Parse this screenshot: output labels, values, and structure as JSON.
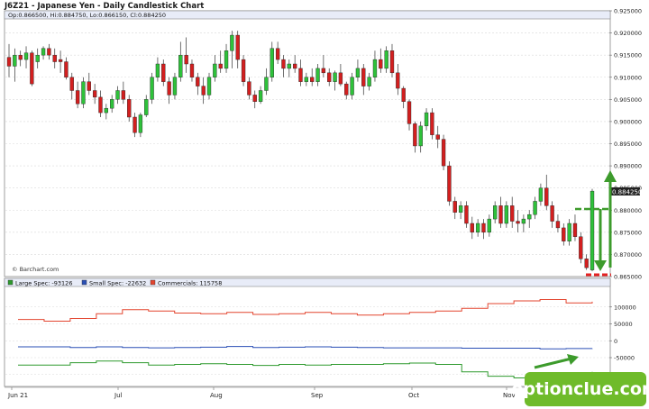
{
  "chart_data": [
    {
      "type": "candlestick",
      "title": "J6Z21 - Japanese Yen - Daily Candlestick Chart",
      "ohlc_label": "Op:0.866500, Hi:0.884750, Lo:0.866150, Cl:0.884250",
      "last_price": "0.884250",
      "credit": "© Barchart.com",
      "ylim": [
        0.865,
        0.925
      ],
      "y_ticks": [
        "0.925000",
        "0.920000",
        "0.915000",
        "0.910000",
        "0.905000",
        "0.900000",
        "0.895000",
        "0.890000",
        "0.885000",
        "0.880000",
        "0.875000",
        "0.870000",
        "0.865000"
      ],
      "x_ticks": [
        "Jun 21",
        "Jul",
        "Aug",
        "Sep",
        "Oct",
        "Nov"
      ],
      "up_color": "#2ec13a",
      "down_color": "#d21f1f",
      "candles": [
        [
          0.9145,
          0.9175,
          0.91,
          0.9125
        ],
        [
          0.9125,
          0.9165,
          0.909,
          0.915
        ],
        [
          0.915,
          0.916,
          0.9125,
          0.914
        ],
        [
          0.914,
          0.917,
          0.912,
          0.9155
        ],
        [
          0.9155,
          0.916,
          0.908,
          0.9085
        ],
        [
          0.9135,
          0.9165,
          0.912,
          0.915
        ],
        [
          0.915,
          0.917,
          0.914,
          0.9165
        ],
        [
          0.9165,
          0.9175,
          0.914,
          0.915
        ],
        [
          0.915,
          0.9165,
          0.912,
          0.9135
        ],
        [
          0.914,
          0.916,
          0.911,
          0.9135
        ],
        [
          0.9135,
          0.9145,
          0.9095,
          0.91
        ],
        [
          0.91,
          0.911,
          0.905,
          0.907
        ],
        [
          0.907,
          0.909,
          0.903,
          0.904
        ],
        [
          0.904,
          0.91,
          0.903,
          0.909
        ],
        [
          0.909,
          0.911,
          0.906,
          0.907
        ],
        [
          0.907,
          0.9085,
          0.904,
          0.9055
        ],
        [
          0.9055,
          0.907,
          0.901,
          0.902
        ],
        [
          0.902,
          0.904,
          0.9005,
          0.903
        ],
        [
          0.903,
          0.906,
          0.902,
          0.905
        ],
        [
          0.905,
          0.908,
          0.904,
          0.907
        ],
        [
          0.907,
          0.909,
          0.904,
          0.905
        ],
        [
          0.905,
          0.906,
          0.9,
          0.901
        ],
        [
          0.901,
          0.902,
          0.8965,
          0.8975
        ],
        [
          0.8975,
          0.902,
          0.8965,
          0.9015
        ],
        [
          0.9015,
          0.906,
          0.901,
          0.905
        ],
        [
          0.905,
          0.911,
          0.904,
          0.91
        ],
        [
          0.91,
          0.9145,
          0.909,
          0.913
        ],
        [
          0.913,
          0.914,
          0.908,
          0.909
        ],
        [
          0.909,
          0.91,
          0.904,
          0.906
        ],
        [
          0.906,
          0.911,
          0.905,
          0.91
        ],
        [
          0.91,
          0.918,
          0.909,
          0.915
        ],
        [
          0.915,
          0.919,
          0.911,
          0.913
        ],
        [
          0.913,
          0.914,
          0.909,
          0.91
        ],
        [
          0.91,
          0.911,
          0.906,
          0.908
        ],
        [
          0.908,
          0.91,
          0.904,
          0.906
        ],
        [
          0.906,
          0.911,
          0.905,
          0.91
        ],
        [
          0.91,
          0.915,
          0.909,
          0.913
        ],
        [
          0.913,
          0.916,
          0.911,
          0.912
        ],
        [
          0.912,
          0.9175,
          0.911,
          0.916
        ],
        [
          0.916,
          0.9205,
          0.912,
          0.9195
        ],
        [
          0.9195,
          0.9205,
          0.912,
          0.914
        ],
        [
          0.914,
          0.915,
          0.908,
          0.909
        ],
        [
          0.909,
          0.91,
          0.905,
          0.906
        ],
        [
          0.906,
          0.907,
          0.903,
          0.9045
        ],
        [
          0.9045,
          0.908,
          0.904,
          0.907
        ],
        [
          0.907,
          0.912,
          0.906,
          0.91
        ],
        [
          0.91,
          0.918,
          0.909,
          0.9165
        ],
        [
          0.9165,
          0.918,
          0.913,
          0.914
        ],
        [
          0.914,
          0.915,
          0.91,
          0.912
        ],
        [
          0.912,
          0.914,
          0.91,
          0.913
        ],
        [
          0.913,
          0.915,
          0.911,
          0.912
        ],
        [
          0.912,
          0.914,
          0.908,
          0.909
        ],
        [
          0.909,
          0.911,
          0.908,
          0.91
        ],
        [
          0.91,
          0.912,
          0.908,
          0.909
        ],
        [
          0.909,
          0.913,
          0.908,
          0.912
        ],
        [
          0.912,
          0.915,
          0.91,
          0.911
        ],
        [
          0.911,
          0.912,
          0.908,
          0.909
        ],
        [
          0.909,
          0.9115,
          0.907,
          0.911
        ],
        [
          0.911,
          0.913,
          0.908,
          0.9085
        ],
        [
          0.9085,
          0.909,
          0.905,
          0.906
        ],
        [
          0.906,
          0.911,
          0.905,
          0.91
        ],
        [
          0.91,
          0.914,
          0.909,
          0.912
        ],
        [
          0.912,
          0.913,
          0.906,
          0.908
        ],
        [
          0.908,
          0.911,
          0.907,
          0.91
        ],
        [
          0.91,
          0.916,
          0.909,
          0.914
        ],
        [
          0.914,
          0.9165,
          0.911,
          0.912
        ],
        [
          0.912,
          0.917,
          0.911,
          0.916
        ],
        [
          0.916,
          0.9175,
          0.91,
          0.911
        ],
        [
          0.911,
          0.913,
          0.906,
          0.9075
        ],
        [
          0.9075,
          0.908,
          0.903,
          0.9045
        ],
        [
          0.9045,
          0.905,
          0.898,
          0.8995
        ],
        [
          0.8995,
          0.9,
          0.893,
          0.8945
        ],
        [
          0.8945,
          0.9,
          0.893,
          0.899
        ],
        [
          0.899,
          0.903,
          0.898,
          0.902
        ],
        [
          0.902,
          0.903,
          0.896,
          0.897
        ],
        [
          0.897,
          0.899,
          0.894,
          0.896
        ],
        [
          0.896,
          0.897,
          0.889,
          0.89
        ],
        [
          0.89,
          0.891,
          0.881,
          0.882
        ],
        [
          0.882,
          0.883,
          0.878,
          0.8795
        ],
        [
          0.8795,
          0.882,
          0.878,
          0.881
        ],
        [
          0.881,
          0.882,
          0.876,
          0.877
        ],
        [
          0.877,
          0.8785,
          0.8735,
          0.875
        ],
        [
          0.875,
          0.878,
          0.874,
          0.877
        ],
        [
          0.877,
          0.878,
          0.8735,
          0.875
        ],
        [
          0.875,
          0.879,
          0.874,
          0.878
        ],
        [
          0.878,
          0.882,
          0.877,
          0.881
        ],
        [
          0.881,
          0.883,
          0.876,
          0.877
        ],
        [
          0.877,
          0.882,
          0.876,
          0.881
        ],
        [
          0.881,
          0.883,
          0.876,
          0.8775
        ],
        [
          0.8775,
          0.88,
          0.875,
          0.877
        ],
        [
          0.877,
          0.879,
          0.875,
          0.878
        ],
        [
          0.878,
          0.88,
          0.876,
          0.879
        ],
        [
          0.879,
          0.883,
          0.878,
          0.882
        ],
        [
          0.882,
          0.886,
          0.881,
          0.885
        ],
        [
          0.885,
          0.888,
          0.88,
          0.881
        ],
        [
          0.881,
          0.882,
          0.876,
          0.8775
        ],
        [
          0.8775,
          0.879,
          0.875,
          0.876
        ],
        [
          0.876,
          0.877,
          0.872,
          0.873
        ],
        [
          0.873,
          0.878,
          0.872,
          0.877
        ],
        [
          0.877,
          0.879,
          0.873,
          0.874
        ],
        [
          0.874,
          0.875,
          0.868,
          0.869
        ],
        [
          0.869,
          0.87,
          0.8665,
          0.867
        ],
        [
          0.8665,
          0.8848,
          0.8662,
          0.8843
        ]
      ]
    },
    {
      "type": "line",
      "title": "COT positions",
      "ylim": [
        -130000,
        150000
      ],
      "y_ticks": [
        "100000",
        "50000",
        "0",
        "-50000",
        "-100000"
      ],
      "x_ticks": [
        "Jun 21",
        "Jul",
        "Aug",
        "Sep",
        "Oct",
        "Nov"
      ],
      "series": [
        {
          "name": "Large Spec",
          "label": "Large Spec: -93126",
          "color": "#2e9a2e",
          "values": [
            -72000,
            -72000,
            -65000,
            -60000,
            -65000,
            -72000,
            -70000,
            -68000,
            -70000,
            -73000,
            -70000,
            -72000,
            -70000,
            -70000,
            -68000,
            -66000,
            -70000,
            -92000,
            -105000,
            -110000,
            -100000,
            -94000,
            -92000
          ]
        },
        {
          "name": "Small Spec",
          "label": "Small Spec: -22632",
          "color": "#2a4fb5",
          "values": [
            -18000,
            -18000,
            -20000,
            -18000,
            -20000,
            -21000,
            -20000,
            -19000,
            -17000,
            -20000,
            -19000,
            -18000,
            -19000,
            -20000,
            -21000,
            -21000,
            -21000,
            -22000,
            -22000,
            -22000,
            -24000,
            -23000,
            -22632
          ]
        },
        {
          "name": "Commercials",
          "label": "Commercials: 115758",
          "color": "#e3452f",
          "values": [
            63000,
            58000,
            66000,
            80000,
            92000,
            88000,
            82000,
            80000,
            84000,
            78000,
            80000,
            84000,
            80000,
            76000,
            80000,
            84000,
            88000,
            96000,
            110000,
            118000,
            122000,
            112000,
            115758
          ]
        }
      ]
    }
  ],
  "brand": {
    "text": "optionclue.com",
    "color": "#6fbb2a"
  },
  "annotations": {
    "arrow_color": "#3d9b2c",
    "dash_color": "#e42222"
  }
}
